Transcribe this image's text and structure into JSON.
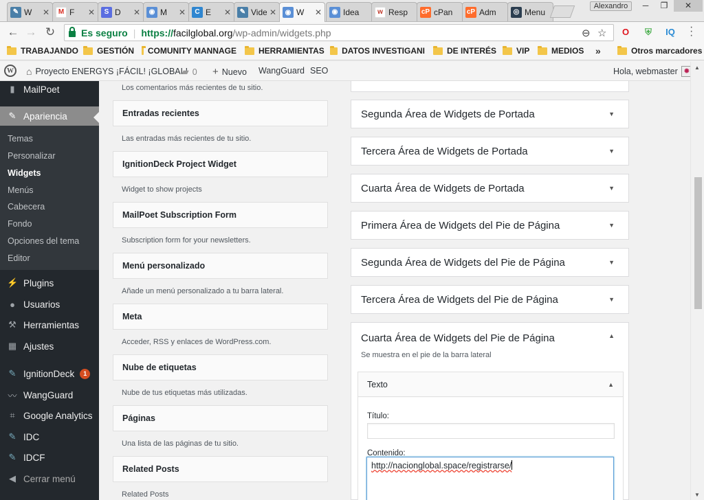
{
  "browser": {
    "tabs": [
      {
        "title": "W",
        "icon": "feather-icon",
        "color": "#4a7fa8"
      },
      {
        "title": "F",
        "icon": "gmail-icon",
        "color": "#d93025"
      },
      {
        "title": "D",
        "icon": "s-icon",
        "color": "#5b6ee1"
      },
      {
        "title": "M",
        "icon": "wp-admin-icon",
        "color": "#5a8fd6"
      },
      {
        "title": "E",
        "icon": "c-icon",
        "color": "#2f86d0"
      },
      {
        "title": "Vide",
        "icon": "feather-icon",
        "color": "#4a7fa8"
      },
      {
        "title": "W",
        "icon": "wp-admin-icon",
        "color": "#5a8fd6"
      },
      {
        "title": "Idea",
        "icon": "wp-admin-icon",
        "color": "#5a8fd6"
      },
      {
        "title": "Resp",
        "icon": "w-icon",
        "color": "#c0392b"
      },
      {
        "title": "cPan",
        "icon": "cpanel-icon",
        "color": "#ff6c2c"
      },
      {
        "title": "Adm",
        "icon": "cpanel-icon",
        "color": "#ff6c2c"
      },
      {
        "title": "Menu",
        "icon": "eye-icon",
        "color": "#2c3e50"
      }
    ],
    "profile": "Alexandro",
    "address": {
      "secure_label": "Es seguro",
      "scheme": "https://",
      "host": "facilglobal.org",
      "path": "/wp-admin/widgets.php"
    },
    "bookmarks": [
      "TRABAJANDO",
      "GESTIÓN",
      "COMUNITY MANNAGE",
      "HERRAMIENTAS",
      "DATOS INVESTIGANI",
      "DE INTERÉS",
      "VIP",
      "MEDIOS"
    ],
    "other_bookmarks": "Otros marcadores"
  },
  "adminbar": {
    "site_name": "Proyecto ENERGYS ¡FÁCIL! ¡GLOBAL!",
    "comments_count": "0",
    "new_label": "Nuevo",
    "wangguard": "WangGuard",
    "seo": "SEO",
    "greeting": "Hola, webmaster"
  },
  "sidebar": {
    "top_item": "MailPoet",
    "current": "Apariencia",
    "submenu": [
      "Temas",
      "Personalizar",
      "Widgets",
      "Menús",
      "Cabecera",
      "Fondo",
      "Opciones del tema",
      "Editor"
    ],
    "items": [
      "Plugins",
      "Usuarios",
      "Herramientas",
      "Ajustes",
      "IgnitionDeck",
      "WangGuard",
      "Google Analytics",
      "IDC",
      "IDCF",
      "Cerrar menú"
    ],
    "ignitiondeck_badge": "1"
  },
  "available_widgets": {
    "top_desc": "Los comentarios más recientes de tu sitio.",
    "widgets": [
      {
        "title": "Entradas recientes",
        "desc": "Las entradas más recientes de tu sitio."
      },
      {
        "title": "IgnitionDeck Project Widget",
        "desc": "Widget to show projects"
      },
      {
        "title": "MailPoet Subscription Form",
        "desc": "Subscription form for your newsletters."
      },
      {
        "title": "Menú personalizado",
        "desc": "Añade un menú personalizado a tu barra lateral."
      },
      {
        "title": "Meta",
        "desc": "Acceder, RSS y enlaces de WordPress.com."
      },
      {
        "title": "Nube de etiquetas",
        "desc": "Nube de tus etiquetas más utilizadas."
      },
      {
        "title": "Páginas",
        "desc": "Una lista de las páginas de tu sitio."
      },
      {
        "title": "Related Posts",
        "desc": "Related Posts"
      }
    ]
  },
  "widget_areas": {
    "collapsed": [
      "Segunda Área de Widgets de Portada",
      "Tercera Área de Widgets de Portada",
      "Cuarta Área de Widgets de Portada",
      "Primera Área de Widgets del Pie de Página",
      "Segunda Área de Widgets del Pie de Página",
      "Tercera Área de Widgets del Pie de Página"
    ],
    "open": {
      "title": "Cuarta Área de Widgets del Pie de Página",
      "desc": "Se muestra en el pie de la barra lateral",
      "widget": {
        "name": "Texto",
        "title_label": "Título:",
        "title_value": "",
        "content_label": "Contenido:",
        "content_value": "http://nacionglobal.space/registrarse/"
      }
    }
  }
}
